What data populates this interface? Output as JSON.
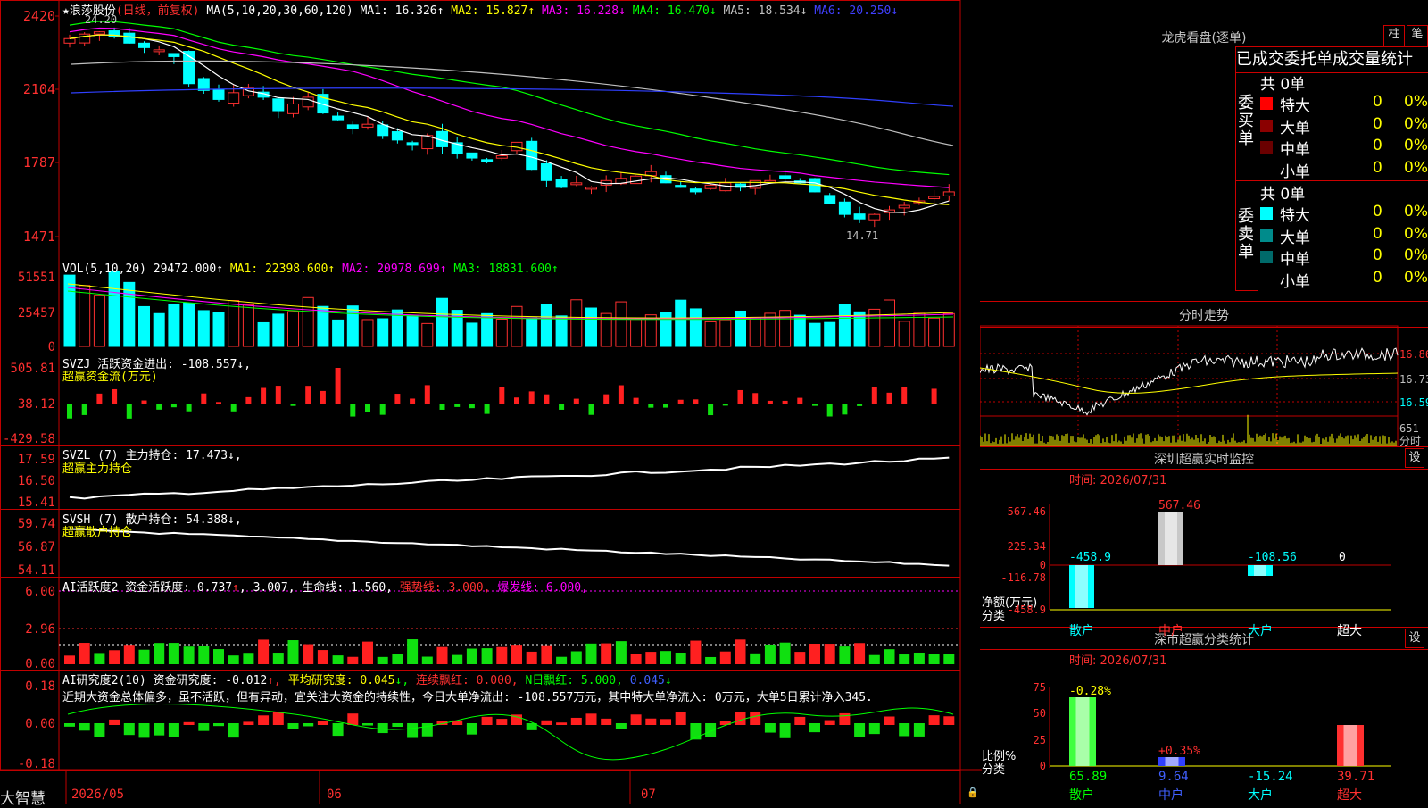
{
  "main": {
    "title": "浪莎股份",
    "title_suffix": "(日线，前复权)",
    "ma_label": "MA(5,10,20,30,60,120)",
    "ma_values": [
      {
        "label": "MA1: 16.326",
        "arrow": "↑",
        "color": "#ffffff"
      },
      {
        "label": "MA2: 15.827",
        "arrow": "↑",
        "color": "#ffff00"
      },
      {
        "label": "MA3: 16.228",
        "arrow": "↓",
        "color": "#ff00ff"
      },
      {
        "label": "MA4: 16.470",
        "arrow": "↓",
        "color": "#00ff00"
      },
      {
        "label": "MA5: 18.534",
        "arrow": "↓",
        "color": "#c0c0c0"
      },
      {
        "label": "MA6: 20.250",
        "arrow": "↓",
        "color": "#4040ff"
      }
    ],
    "y_ticks": [
      "2420",
      "2104",
      "1787",
      "1471"
    ],
    "high_mark": "24.20",
    "low_mark": "14.71"
  },
  "vol": {
    "header": "VOL(5,10,20)",
    "vals": [
      {
        "label": "29472.000",
        "arrow": "↑",
        "color": "#ffffff"
      },
      {
        "label": "MA1: 22398.600",
        "arrow": "↑",
        "color": "#ffff00"
      },
      {
        "label": "MA2: 20978.699",
        "arrow": "↑",
        "color": "#ff00ff"
      },
      {
        "label": "MA3: 18831.600",
        "arrow": "↑",
        "color": "#00ff00"
      }
    ],
    "y_ticks": [
      "51551",
      "25457",
      "0"
    ]
  },
  "svzj": {
    "header": "SVZJ  活跃资金进出: -108.557↓,",
    "sub": "超赢资金流(万元)",
    "y_ticks": [
      "505.81",
      "38.12",
      "-429.58"
    ]
  },
  "svzl": {
    "header": "SVZL (7) 主力持仓: 17.473↓,",
    "sub": "超赢主力持仓",
    "y_ticks": [
      "17.59",
      "16.50",
      "15.41"
    ]
  },
  "svsh": {
    "header": "SVSH (7) 散户持仓: 54.388↓,",
    "sub": "超赢散户持仓",
    "y_ticks": [
      "59.74",
      "56.87",
      "54.11"
    ]
  },
  "ai1": {
    "header_parts": [
      {
        "text": "AI活跃度2 资金活跃度: 0.737",
        "color": "#ffffff"
      },
      {
        "text": "↑",
        "color": "#ff3030"
      },
      {
        "text": ", 3.007, 生命线: 1.560, ",
        "color": "#ffffff"
      },
      {
        "text": "强势线: 3.000, ",
        "color": "#ff3030"
      },
      {
        "text": "爆发线: 6.000,",
        "color": "#ff00ff"
      }
    ],
    "y_ticks": [
      "6.00",
      "2.96",
      "0.00"
    ]
  },
  "ai2": {
    "header_parts": [
      {
        "text": "AI研究度2(10) 资金研究度: -0.012",
        "color": "#ffffff"
      },
      {
        "text": "↑, ",
        "color": "#ff3030"
      },
      {
        "text": "平均研究度: 0.045",
        "color": "#ffff00"
      },
      {
        "text": "↓, ",
        "color": "#00ff00"
      },
      {
        "text": "连续飘红: 0.000, ",
        "color": "#ff3030"
      },
      {
        "text": "N日飘红: 5.000, ",
        "color": "#00ff00"
      },
      {
        "text": "0.045",
        "color": "#4060ff"
      },
      {
        "text": "↓",
        "color": "#00ff00"
      }
    ],
    "note": "近期大资金总体偏多，虽不活跃，但有异动，宜关注大资金的持续性，今日大单净流出: -108.557万元，其中特大单净流入: 0万元，大单5日累计净入345.",
    "y_ticks": [
      "0.18",
      "0.00",
      "-0.18"
    ]
  },
  "bottom": {
    "brand": "大智慧",
    "dates": [
      "2026/05",
      "06",
      "07"
    ]
  },
  "right": {
    "lhb": {
      "title": "龙虎看盘(逐单)",
      "btn1": "柱",
      "btn2": "笔",
      "heading": "已成交委托单成交量统计",
      "buy_label": "委买单",
      "sell_label": "委卖单",
      "buy_total": "共 0单",
      "sell_total": "共 0单",
      "buy_rows": [
        {
          "name": "特大",
          "val": "0",
          "pct": "0%",
          "color": "#ff0000"
        },
        {
          "name": "大单",
          "val": "0",
          "pct": "0%",
          "color": "#8b0000"
        },
        {
          "name": "中单",
          "val": "0",
          "pct": "0%",
          "color": "#6a0000"
        },
        {
          "name": "小单",
          "val": "0",
          "pct": "0%",
          "color": "#000000"
        }
      ],
      "sell_rows": [
        {
          "name": "特大",
          "val": "0",
          "pct": "0%",
          "color": "#00ffff"
        },
        {
          "name": "大单",
          "val": "0",
          "pct": "0%",
          "color": "#008b8b"
        },
        {
          "name": "中单",
          "val": "0",
          "pct": "0%",
          "color": "#006a6a"
        },
        {
          "name": "小单",
          "val": "0",
          "pct": "0%",
          "color": "#000000"
        }
      ]
    },
    "fs": {
      "title": "分时走势",
      "price_ticks": [
        "16.86",
        "16.73",
        "16.59"
      ],
      "vol_label": "651",
      "vol_unit": "分时"
    },
    "sz": {
      "title": "深圳超赢实时监控",
      "btn": "设",
      "time": "时间: 2026/07/31",
      "y_ticks": [
        "567.46",
        "225.34",
        "0",
        "-116.78",
        "-458.9"
      ],
      "val_labels": [
        "-458.9",
        "567.46",
        "-108.56",
        "0"
      ],
      "unit": "净额(万元)",
      "cat_label": "分类",
      "cats": [
        "散户",
        "中户",
        "大户",
        "超大"
      ]
    },
    "sm": {
      "title": "深市超赢分类统计",
      "btn": "设",
      "time": "时间: 2026/07/31",
      "y_ticks": [
        "75",
        "50",
        "25",
        "0"
      ],
      "top_labels": [
        "-0.28%",
        "+0.35%"
      ],
      "bottom_vals": [
        "65.89",
        "9.64",
        "-15.24",
        "39.71"
      ],
      "unit": "比例%",
      "cat_label": "分类",
      "cats": [
        "散户",
        "中户",
        "大户",
        "超大"
      ]
    }
  }
}
